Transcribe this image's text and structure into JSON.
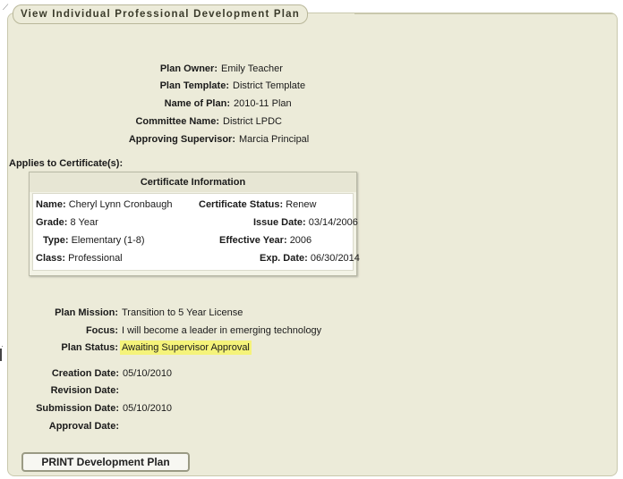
{
  "panel": {
    "title": "View Individual Professional Development Plan"
  },
  "plan": {
    "owner_label": "Plan Owner:",
    "owner": "Emily Teacher",
    "template_label": "Plan Template:",
    "template": "District Template",
    "name_label": "Name of Plan:",
    "name": "2010-11 Plan",
    "committee_label": "Committee Name:",
    "committee": "District LPDC",
    "supervisor_label": "Approving Supervisor:",
    "supervisor": "Marcia Principal",
    "applies_label": "Applies to Certificate(s):"
  },
  "certificate": {
    "heading": "Certificate Information",
    "name_label": "Name:",
    "name": "Cheryl Lynn Cronbaugh",
    "status_label": "Certificate Status:",
    "status": "Renew",
    "grade_label": "Grade:",
    "grade": "8 Year",
    "issue_label": "Issue Date:",
    "issue": "03/14/2006",
    "type_label": "Type:",
    "type": "Elementary (1-8)",
    "effective_label": "Effective Year:",
    "effective": "2006",
    "class_label": "Class:",
    "class": "Professional",
    "exp_label": "Exp. Date:",
    "exp": "06/30/2014"
  },
  "mission": {
    "mission_label": "Plan Mission:",
    "mission": "Transition to 5 Year License",
    "focus_label": "Focus:",
    "focus": "I will become a leader in emerging technology",
    "status_label": "Plan Status:",
    "status": "Awaiting Supervisor Approval",
    "highlight_color": "#f5f37a"
  },
  "dates": {
    "creation_label": "Creation Date:",
    "creation": "05/10/2010",
    "revision_label": "Revision Date:",
    "revision": "",
    "submission_label": "Submission Date:",
    "submission": "05/10/2010",
    "approval_label": "Approval Date:",
    "approval": ""
  },
  "actions": {
    "print_label": "PRINT Development Plan"
  }
}
